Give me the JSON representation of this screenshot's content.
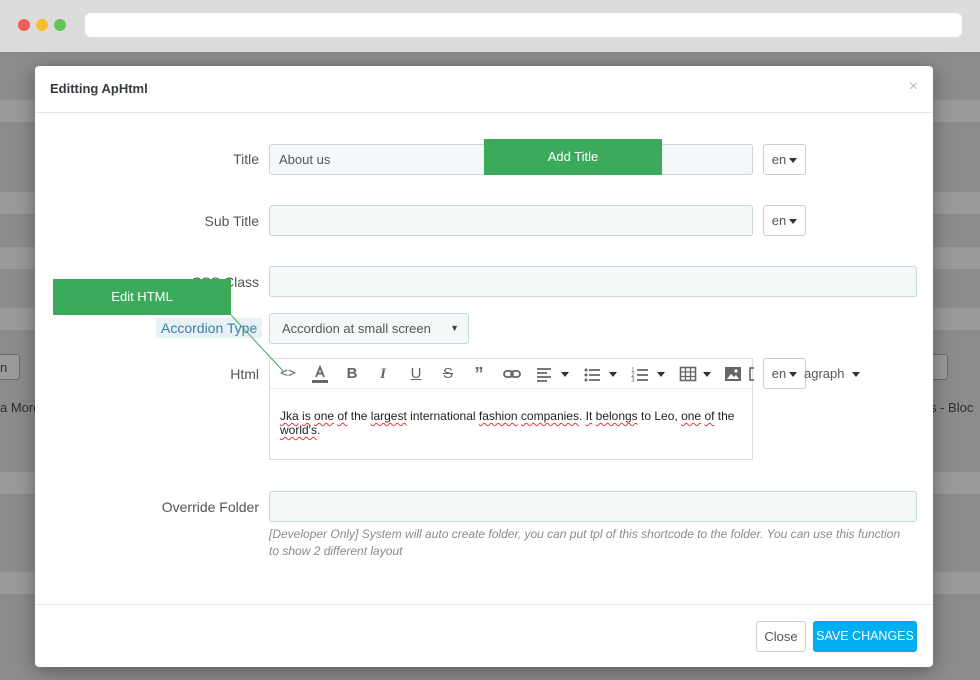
{
  "background": {
    "text_left_1": "n",
    "text_left_2": "a More",
    "text_right_1": "s - Bloc"
  },
  "modal": {
    "title": "Editting ApHtml",
    "close_glyph": "×",
    "fields": {
      "title": {
        "label": "Title",
        "value": "About us",
        "lang": "en"
      },
      "subtitle": {
        "label": "Sub Title",
        "value": "",
        "lang": "en"
      },
      "css_class": {
        "label": "CSS Class",
        "value": ""
      },
      "accordion_type": {
        "label": "Accordion Type",
        "value": "Accordion at small screen"
      },
      "html": {
        "label": "Html",
        "lang": "en",
        "toolbar_extra": "agraph",
        "content": {
          "w1": "Jka",
          "t1": " ",
          "w2": "is",
          "t2": " ",
          "w3": "one",
          "t3": " ",
          "w4": "of",
          "t4": " the ",
          "w5": "largest",
          "t5": " international ",
          "w6": "fashion",
          "t6": " ",
          "w7": "companies",
          "t7": ". ",
          "w8": "It",
          "t8": " ",
          "w9": "belongs",
          "t9": " to Leo, ",
          "w10": "one",
          "t10": " ",
          "w11": "of",
          "t11": " the ",
          "w12": "world's",
          "t12": "."
        }
      },
      "override_folder": {
        "label": "Override Folder",
        "value": "",
        "help": "[Developer Only] System will auto create folder, you can put tpl of this shortcode to the folder. You can use this function to show 2 different layout"
      }
    },
    "footer": {
      "close_label": "Close",
      "save_label": "SAVE CHANGES"
    }
  },
  "callouts": {
    "add_title": "Add Title",
    "edit_html": "Edit HTML"
  },
  "colors": {
    "callout_green": "#3caa5b",
    "save_blue": "#00aff0",
    "accent_link": "#3b7fa8"
  }
}
